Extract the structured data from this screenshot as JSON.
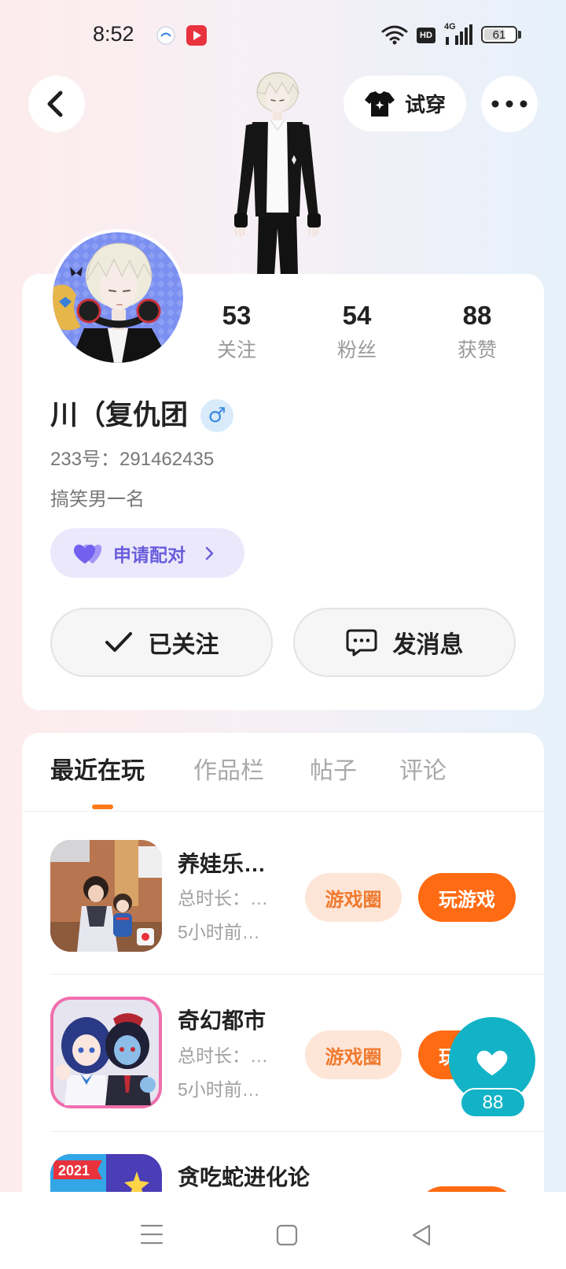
{
  "status_bar": {
    "time": "8:52",
    "hd_label": "HD",
    "network": "4G",
    "battery": "61",
    "icons": [
      "ifly-app-icon",
      "video-app-icon",
      "wifi-icon",
      "hd-icon",
      "signal-icon",
      "battery-icon"
    ]
  },
  "header": {
    "try_on_label": "试穿",
    "icons": [
      "back-icon",
      "tshirt-icon",
      "more-icon"
    ]
  },
  "stats": [
    {
      "value": "53",
      "label": "关注"
    },
    {
      "value": "54",
      "label": "粉丝"
    },
    {
      "value": "88",
      "label": "获赞"
    }
  ],
  "profile": {
    "name": "川（复仇团",
    "gender": "♂",
    "id_line": "233号：291462435",
    "bio": "搞笑男一名",
    "pair_label": "申请配对"
  },
  "actions": {
    "follow_label": "已关注",
    "message_label": "发消息"
  },
  "tabs": {
    "items": [
      "最近在玩",
      "作品栏",
      "帖子",
      "评论"
    ],
    "active_index": 0
  },
  "games": [
    {
      "title": "养娃乐…",
      "duration": "总时长：…",
      "last_played": "5小时前…",
      "circle_label": "游戏圈",
      "play_label": "玩游戏"
    },
    {
      "title": "奇幻都市",
      "duration": "总时长：…",
      "last_played": "5小时前…",
      "circle_label": "游戏圈",
      "play_label": "玩游戏"
    },
    {
      "title": "贪吃蛇进化论",
      "icon_badge": "2021"
    }
  ],
  "like_fab": {
    "count": "88"
  },
  "bottom_nav": {
    "icons": [
      "menu-icon",
      "home-icon",
      "back-nav-icon"
    ]
  },
  "colors": {
    "accent_orange": "#ff6b12",
    "circle_button_bg": "#fde6d8",
    "pair_purple": "#6a5ddc",
    "gender_blue": "#3d8ae0",
    "fab_teal": "#12b3c6"
  }
}
